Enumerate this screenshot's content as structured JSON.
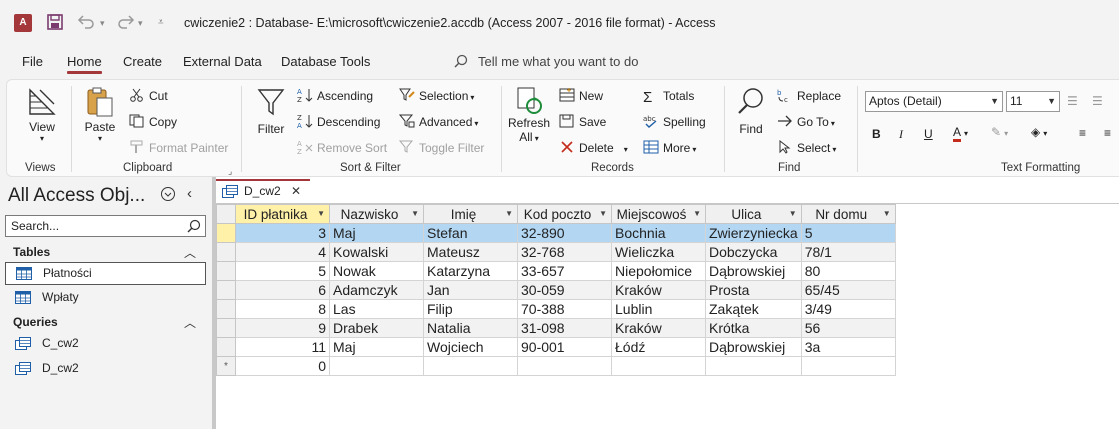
{
  "window": {
    "title": "cwiczenie2 : Database- E:\\microsoft\\cwiczenie2.accdb (Access 2007 - 2016 file format)  -  Access",
    "app_badge": "A",
    "accent_color": "#a4373a"
  },
  "menu": {
    "tabs": [
      "File",
      "Home",
      "Create",
      "External Data",
      "Database Tools"
    ],
    "active_tab": "Home",
    "tell_me": "Tell me what you want to do"
  },
  "ribbon": {
    "views": {
      "view_label": "View",
      "group": "Views"
    },
    "clipboard": {
      "paste": "Paste",
      "cut": "Cut",
      "copy": "Copy",
      "format_painter": "Format Painter",
      "group": "Clipboard"
    },
    "sort_filter": {
      "filter": "Filter",
      "ascending": "Ascending",
      "descending": "Descending",
      "remove_sort": "Remove Sort",
      "selection": "Selection",
      "advanced": "Advanced",
      "toggle_filter": "Toggle Filter",
      "group": "Sort & Filter"
    },
    "records": {
      "refresh": "Refresh",
      "refresh_all": "All",
      "new": "New",
      "save": "Save",
      "delete": "Delete",
      "totals": "Totals",
      "spelling": "Spelling",
      "more": "More",
      "group": "Records"
    },
    "find": {
      "find": "Find",
      "replace": "Replace",
      "goto": "Go To",
      "select": "Select",
      "group": "Find"
    },
    "text_formatting": {
      "font": "Aptos (Detail)",
      "size": "11",
      "bold": "B",
      "italic": "I",
      "underline": "U",
      "font_color": "A",
      "group": "Text Formatting"
    }
  },
  "nav": {
    "title": "All Access Obj...",
    "search_placeholder": "Search...",
    "sections": [
      {
        "name": "Tables",
        "items": [
          "Płatności",
          "Wpłaty"
        ]
      },
      {
        "name": "Queries",
        "items": [
          "C_cw2",
          "D_cw2"
        ]
      }
    ]
  },
  "document": {
    "tab_label": "D_cw2",
    "columns": [
      "ID płatnika",
      "Nazwisko",
      "Imię",
      "Kod poczto",
      "Miejscowoś",
      "Ulica",
      "Nr domu"
    ],
    "rows": [
      [
        "3",
        "Maj",
        "Stefan",
        "32-890",
        "Bochnia",
        "Zwierzyniecka",
        "5"
      ],
      [
        "4",
        "Kowalski",
        "Mateusz",
        "32-768",
        "Wieliczka",
        "Dobczycka",
        "78/1"
      ],
      [
        "5",
        "Nowak",
        "Katarzyna",
        "33-657",
        "Niepołomice",
        "Dąbrowskiej",
        "80"
      ],
      [
        "6",
        "Adamczyk",
        "Jan",
        "30-059",
        "Kraków",
        "Prosta",
        "65/45"
      ],
      [
        "8",
        "Las",
        "Filip",
        "70-388",
        "Lublin",
        "Zakątek",
        "3/49"
      ],
      [
        "9",
        "Drabek",
        "Natalia",
        "31-098",
        "Kraków",
        "Krótka",
        "56"
      ],
      [
        "11",
        "Maj",
        "Wojciech",
        "90-001",
        "Łódź",
        "Dąbrowskiej",
        "3a"
      ]
    ],
    "new_row_marker": "*",
    "new_row_default": "0",
    "current_row": 0
  }
}
